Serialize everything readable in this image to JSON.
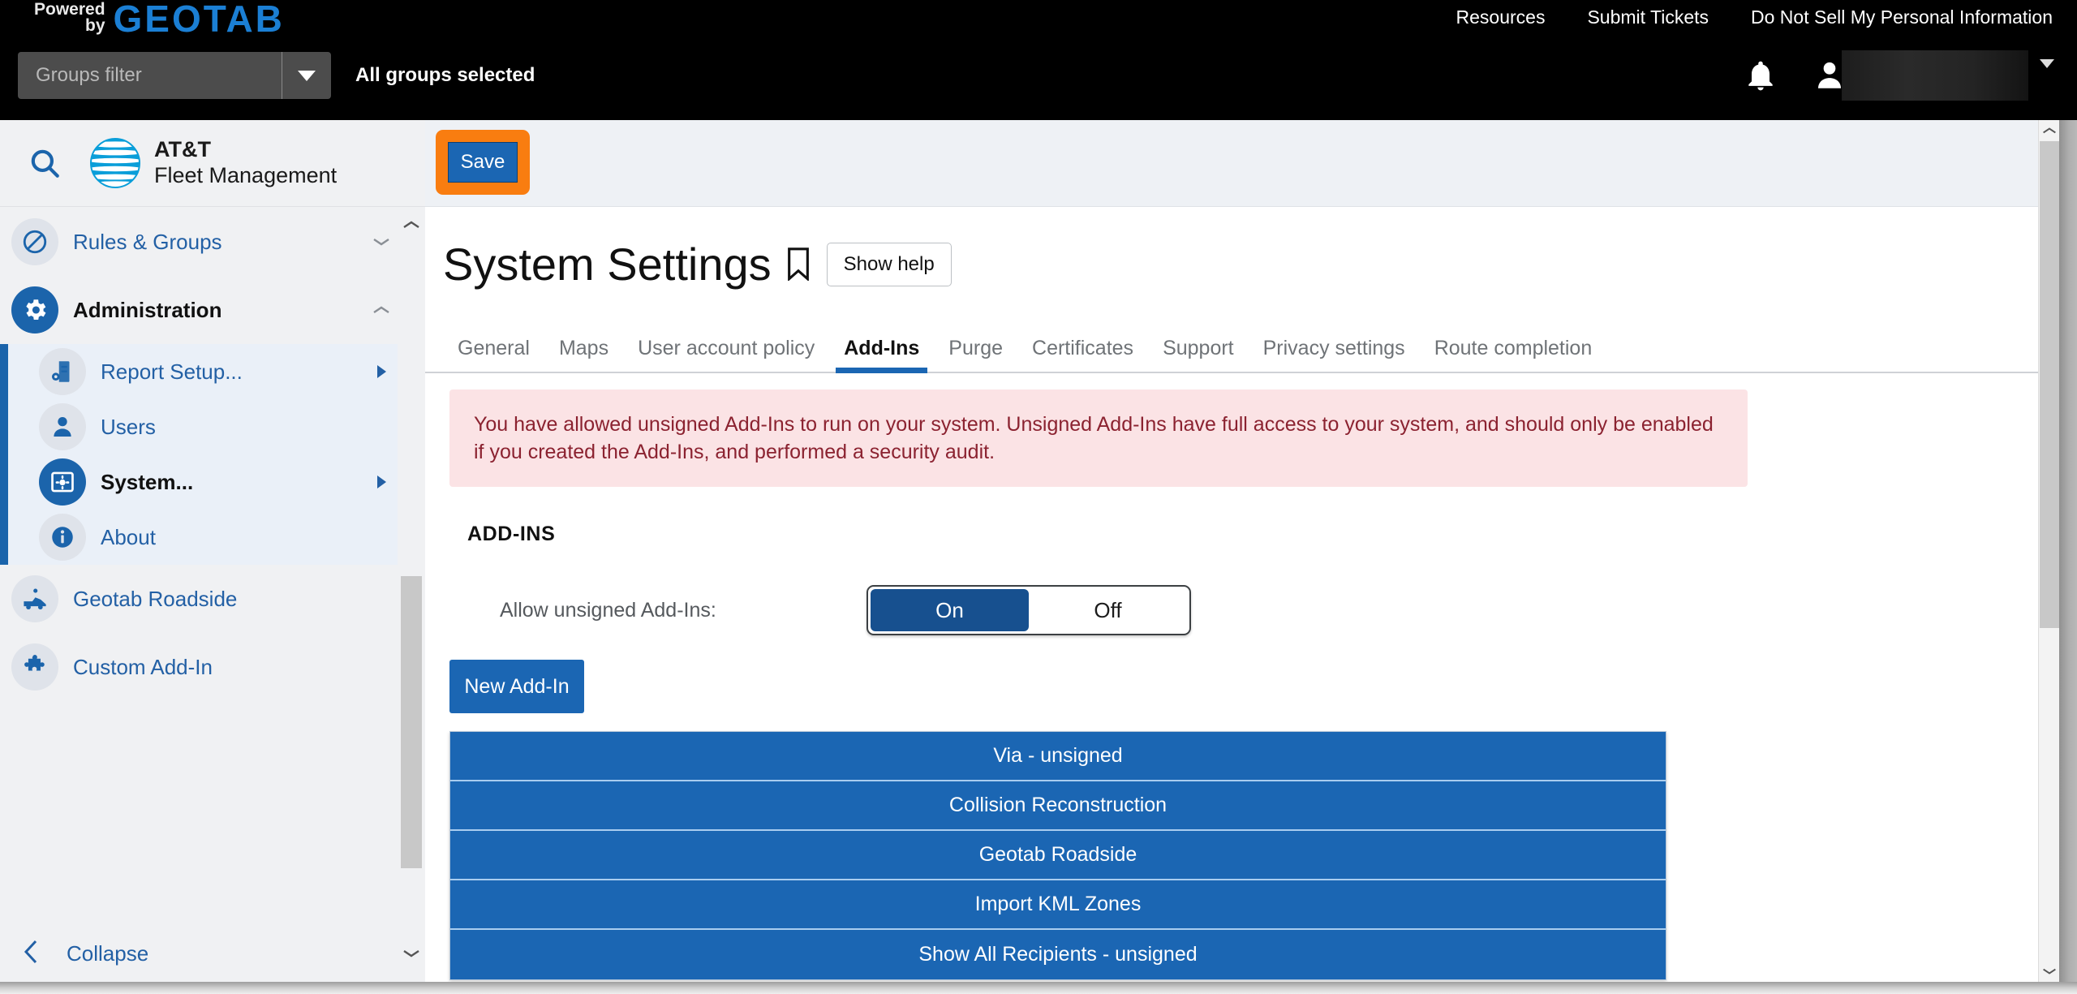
{
  "topbar": {
    "powered_line1": "Powered",
    "powered_line2": "by",
    "brand": "GEOTAB",
    "links": [
      "Resources",
      "Submit Tickets",
      "Do Not Sell My Personal Information"
    ],
    "groups_filter_placeholder": "Groups filter",
    "groups_filter_value": "",
    "groups_status": "All groups selected",
    "notification_icon": "bell-icon",
    "account_icon": "person-icon",
    "account_name": ""
  },
  "sidebar": {
    "search_icon": "search-icon",
    "product_line1": "AT&T",
    "product_line2": "Fleet Management",
    "items": [
      {
        "label": "Rules & Groups",
        "icon": "no-entry-icon",
        "state": "collapsed",
        "bold": false
      },
      {
        "label": "Administration",
        "icon": "gear-icon",
        "state": "expanded",
        "bold": true
      }
    ],
    "sub_items": [
      {
        "label": "Report Setup...",
        "icon": "report-setup-icon",
        "has_submenu": true,
        "bold": false
      },
      {
        "label": "Users",
        "icon": "user-icon",
        "has_submenu": false,
        "bold": false
      },
      {
        "label": "System...",
        "icon": "system-settings-icon",
        "has_submenu": true,
        "bold": true
      },
      {
        "label": "About",
        "icon": "info-icon",
        "has_submenu": false,
        "bold": false
      }
    ],
    "footer_items": [
      {
        "label": "Geotab Roadside",
        "icon": "tow-truck-icon"
      },
      {
        "label": "Custom Add-In",
        "icon": "puzzle-piece-icon"
      }
    ],
    "collapse_label": "Collapse",
    "collapse_icon": "chevron-left-icon"
  },
  "main": {
    "save_label": "Save",
    "page_title": "System Settings",
    "bookmark_icon": "bookmark-icon",
    "show_help_label": "Show help",
    "tabs": [
      {
        "label": "General",
        "active": false
      },
      {
        "label": "Maps",
        "active": false
      },
      {
        "label": "User account policy",
        "active": false
      },
      {
        "label": "Add-Ins",
        "active": true
      },
      {
        "label": "Purge",
        "active": false
      },
      {
        "label": "Certificates",
        "active": false
      },
      {
        "label": "Support",
        "active": false
      },
      {
        "label": "Privacy settings",
        "active": false
      },
      {
        "label": "Route completion",
        "active": false
      }
    ],
    "warning_text": "You have allowed unsigned Add-Ins to run on your system. Unsigned Add-Ins have full access to your system, and should only be enabled if you created the Add-Ins, and performed a security audit.",
    "section_heading": "ADD-INS",
    "toggle_label": "Allow unsigned Add-Ins:",
    "toggle_on_label": "On",
    "toggle_off_label": "Off",
    "toggle_value": "On",
    "new_addin_label": "New Add-In",
    "addins": [
      "Via - unsigned",
      "Collision Reconstruction",
      "Geotab Roadside",
      "Import KML Zones",
      "Show All Recipients - unsigned"
    ]
  },
  "colors": {
    "brand_blue": "#1b66b3",
    "toggle_on": "#17508f",
    "highlight_orange": "#f97d10",
    "warning_bg": "#fbe3e5",
    "warning_text": "#8b2230",
    "att_blue": "#0a9ed9"
  }
}
